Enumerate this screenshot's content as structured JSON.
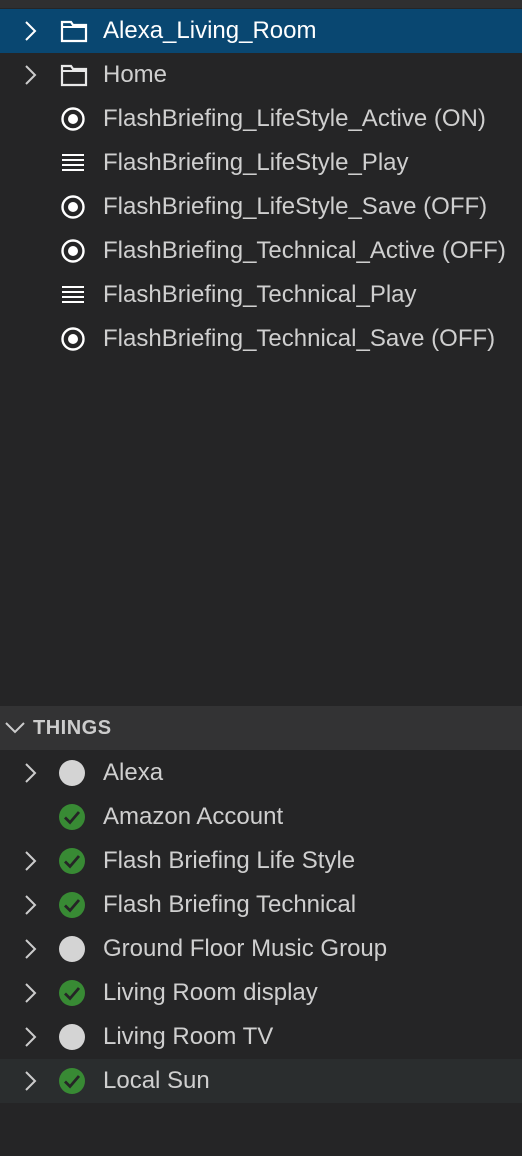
{
  "colors": {
    "background": "#252526",
    "selected_row": "#094771",
    "hover_row": "#2a2d2e",
    "section_header": "#333334",
    "status_online": "#388a34",
    "status_unknown": "#d4d4d4",
    "text": "#cccccc"
  },
  "items_tree": {
    "rows": [
      {
        "label": "Alexa_Living_Room",
        "icon": "folder-icon",
        "expandable": true,
        "selected": true
      },
      {
        "label": "Home",
        "icon": "folder-icon",
        "expandable": true,
        "selected": false
      },
      {
        "label": "FlashBriefing_LifeStyle_Active (ON)",
        "icon": "radio-icon",
        "expandable": false
      },
      {
        "label": "FlashBriefing_LifeStyle_Play",
        "icon": "list-icon",
        "expandable": false
      },
      {
        "label": "FlashBriefing_LifeStyle_Save (OFF)",
        "icon": "radio-icon",
        "expandable": false
      },
      {
        "label": "FlashBriefing_Technical_Active (OFF)",
        "icon": "radio-icon",
        "expandable": false
      },
      {
        "label": "FlashBriefing_Technical_Play",
        "icon": "list-icon",
        "expandable": false
      },
      {
        "label": "FlashBriefing_Technical_Save (OFF)",
        "icon": "radio-icon",
        "expandable": false
      }
    ]
  },
  "things": {
    "header": "THINGS",
    "rows": [
      {
        "label": "Alexa",
        "status_icon": "status-unknown-icon",
        "expandable": true
      },
      {
        "label": "Amazon Account",
        "status_icon": "status-online-icon",
        "expandable": false
      },
      {
        "label": "Flash Briefing Life Style",
        "status_icon": "status-online-icon",
        "expandable": true
      },
      {
        "label": "Flash Briefing Technical",
        "status_icon": "status-online-icon",
        "expandable": true
      },
      {
        "label": "Ground Floor Music Group",
        "status_icon": "status-unknown-icon",
        "expandable": true
      },
      {
        "label": "Living Room display",
        "status_icon": "status-online-icon",
        "expandable": true
      },
      {
        "label": "Living Room TV",
        "status_icon": "status-unknown-icon",
        "expandable": true
      },
      {
        "label": "Local Sun",
        "status_icon": "status-online-icon",
        "expandable": true
      }
    ]
  }
}
